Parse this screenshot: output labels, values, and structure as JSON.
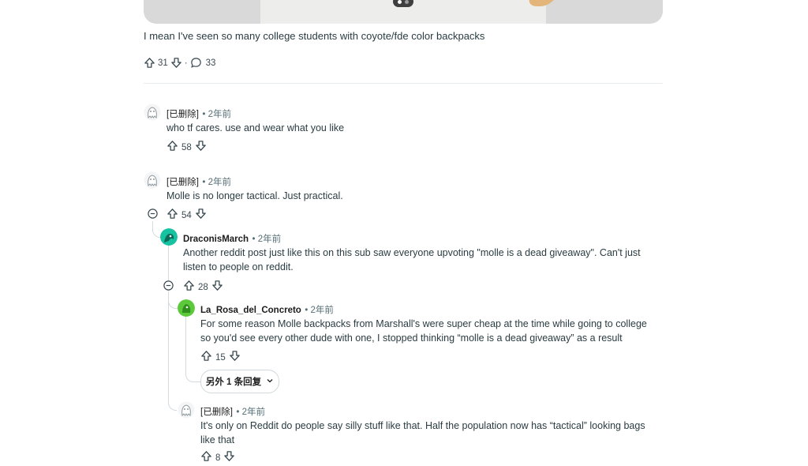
{
  "post": {
    "body": "I mean I've seen so many college students with coyote/fde color backpacks",
    "upvotes": "31",
    "comments": "33",
    "separator": "·"
  },
  "comments": [
    {
      "user": "[已删除]",
      "time": "• 2年前",
      "text": "who tf cares. use and wear what you like",
      "votes": "58"
    },
    {
      "user": "[已删除]",
      "time": "• 2年前",
      "text": "Molle is no longer tactical. Just practical.",
      "votes": "54"
    },
    {
      "user": "DraconisMarch",
      "time": "• 2年前",
      "text_line1": "Another reddit post just like this on this sub saw everyone upvoting \"molle is a dead giveaway\". Can't just",
      "text_line2": "listen to people on reddit.",
      "votes": "28"
    },
    {
      "user": "La_Rosa_del_Concreto",
      "time": "• 2年前",
      "text_line1": "For some reason Molle backpacks from Marshall's were super cheap at the time while going to college",
      "text_line2": "so you'd see every other dude with one, I stopped thinking “molle is a dead giveaway” as a result",
      "votes": "15"
    },
    {
      "user": "[已删除]",
      "time": "• 2年前",
      "text_line1": "It's only on Reddit do people say silly stuff like that. Half the population now has “tactical” looking bags",
      "text_line2": "like that",
      "votes": "8"
    }
  ],
  "more_replies": "另外 1 条回复",
  "colors": {
    "accent_teal": "#16c2a1",
    "accent_green": "#5cc93b"
  },
  "icons": [
    "upvote-icon",
    "downvote-icon",
    "comment-icon",
    "collapse-icon",
    "chevron-down-icon",
    "deleted-avatar-icon"
  ]
}
